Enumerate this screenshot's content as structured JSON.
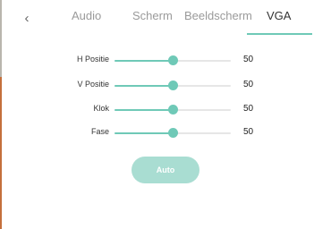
{
  "back_icon": "chevron-left-icon",
  "colors": {
    "accent": "#6fc9b7",
    "button": "#a9ddd2"
  },
  "tabs": [
    {
      "label": "Audio",
      "active": false
    },
    {
      "label": "Scherm",
      "active": false
    },
    {
      "label": "Beeldscherm",
      "active": false
    },
    {
      "label": "VGA",
      "active": true
    }
  ],
  "settings": [
    {
      "label": "H Positie",
      "value": "50",
      "level": 0.5
    },
    {
      "label": "V Positie",
      "value": "50",
      "level": 0.5
    },
    {
      "label": "Klok",
      "value": "50",
      "level": 0.5
    },
    {
      "label": "Fase",
      "value": "50",
      "level": 0.5
    }
  ],
  "auto_button": {
    "label": "Auto"
  }
}
